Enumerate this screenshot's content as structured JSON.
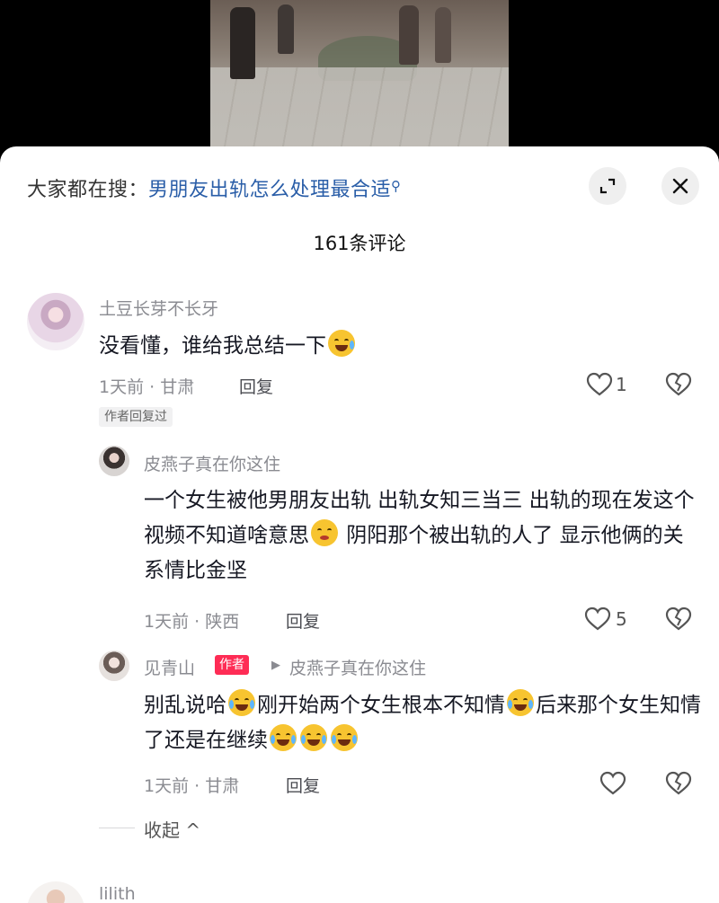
{
  "search": {
    "prefix": "大家都在搜：",
    "term": "男朋友出轨怎么处理最合适",
    "icon": "search-icon"
  },
  "header": {
    "comment_count": "161条评论"
  },
  "comments": [
    {
      "username": "土豆长芽不长牙",
      "text": "没看懂，谁给我总结一下",
      "emoji": "grinning-sweat-emoji",
      "time_location": "1天前 · 甘肃",
      "reply_label": "回复",
      "like_count": "1",
      "badge": "作者回复过",
      "replies": [
        {
          "username": "皮燕子真在你这住",
          "text_part1": "一个女生被他男朋友出轨 出轨女知三当三 出轨的现在发这个视频不知道啥意思",
          "text_part2": " 阴阳那个被出轨的人了 显示他俩的关系情比金坚",
          "emoji": "woozy-face-emoji",
          "time_location": "1天前 · 陕西",
          "reply_label": "回复",
          "like_count": "5"
        },
        {
          "username": "见青山",
          "author_tag": "作者",
          "reply_to": "皮燕子真在你这住",
          "text_part1": "别乱说哈",
          "text_part2": "刚开始两个女生根本不知情",
          "text_part3": "后来那个女生知情了还是在继续",
          "emoji": "loudly-crying-emoji",
          "time_location": "1天前 · 甘肃",
          "reply_label": "回复",
          "like_count": ""
        }
      ],
      "collapse_label": "收起 ^"
    },
    {
      "username": "lilith"
    }
  ]
}
